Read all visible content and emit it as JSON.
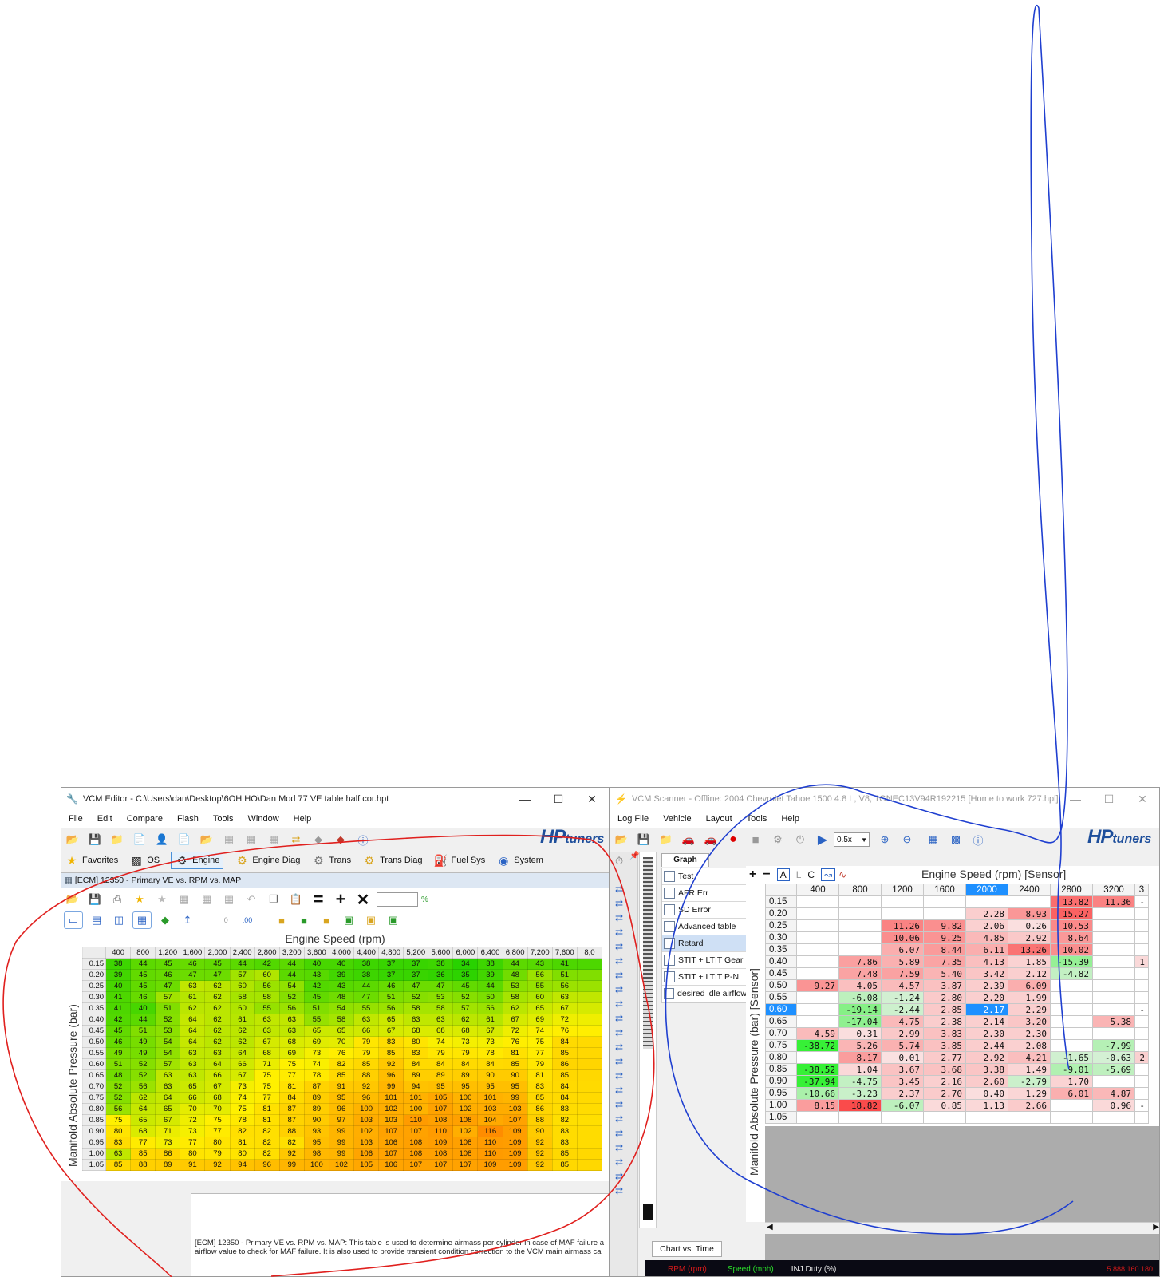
{
  "editor": {
    "title": "VCM Editor - C:\\Users\\dan\\Desktop\\6OH HO\\Dan Mod 77 VE table half cor.hpt",
    "menu": [
      "File",
      "Edit",
      "Compare",
      "Flash",
      "Tools",
      "Window",
      "Help"
    ],
    "logo_hp": "HP",
    "logo_tuners": "tuners",
    "categories": [
      "Favorites",
      "OS",
      "Engine",
      "Engine Diag",
      "Trans",
      "Trans Diag",
      "Fuel Sys",
      "System"
    ],
    "selected_category": "Engine",
    "table_window_title": "[ECM] 12350 - Primary VE vs. RPM vs. MAP",
    "percent_value": "",
    "percent_unit": "%",
    "col_axis_label": "Engine Speed (rpm)",
    "row_axis_label": "Manifold Absolute Pressure (bar)",
    "columns": [
      "400",
      "800",
      "1,200",
      "1,600",
      "2,000",
      "2,400",
      "2,800",
      "3,200",
      "3,600",
      "4,000",
      "4,400",
      "4,800",
      "5,200",
      "5,600",
      "6,000",
      "6,400",
      "6,800",
      "7,200",
      "7,600",
      "8,0"
    ],
    "rows": [
      {
        "p": "0.15",
        "v": [
          38,
          44,
          45,
          46,
          45,
          44,
          42,
          44,
          40,
          40,
          38,
          37,
          37,
          38,
          34,
          38,
          44,
          43,
          41
        ]
      },
      {
        "p": "0.20",
        "v": [
          39,
          45,
          46,
          47,
          47,
          57,
          60,
          44,
          43,
          39,
          38,
          37,
          37,
          36,
          35,
          39,
          48,
          56,
          51
        ]
      },
      {
        "p": "0.25",
        "v": [
          40,
          45,
          47,
          63,
          62,
          60,
          56,
          54,
          42,
          43,
          44,
          46,
          47,
          47,
          45,
          44,
          53,
          55,
          56
        ]
      },
      {
        "p": "0.30",
        "v": [
          41,
          46,
          57,
          61,
          62,
          58,
          58,
          52,
          45,
          48,
          47,
          51,
          52,
          53,
          52,
          50,
          58,
          60,
          63
        ]
      },
      {
        "p": "0.35",
        "v": [
          41,
          40,
          51,
          62,
          62,
          60,
          55,
          56,
          51,
          54,
          55,
          56,
          58,
          58,
          57,
          56,
          62,
          65,
          67
        ]
      },
      {
        "p": "0.40",
        "v": [
          42,
          44,
          52,
          64,
          62,
          61,
          63,
          63,
          55,
          58,
          63,
          65,
          63,
          63,
          62,
          61,
          67,
          69,
          72
        ]
      },
      {
        "p": "0.45",
        "v": [
          45,
          51,
          53,
          64,
          62,
          62,
          63,
          63,
          65,
          65,
          66,
          67,
          68,
          68,
          68,
          67,
          72,
          74,
          76
        ]
      },
      {
        "p": "0.50",
        "v": [
          46,
          49,
          54,
          64,
          62,
          62,
          67,
          68,
          69,
          70,
          79,
          83,
          80,
          74,
          73,
          73,
          76,
          75,
          84
        ]
      },
      {
        "p": "0.55",
        "v": [
          49,
          49,
          54,
          63,
          63,
          64,
          68,
          69,
          73,
          76,
          79,
          85,
          83,
          79,
          79,
          78,
          81,
          77,
          85
        ]
      },
      {
        "p": "0.60",
        "v": [
          51,
          52,
          57,
          63,
          64,
          66,
          71,
          75,
          74,
          82,
          85,
          92,
          84,
          84,
          84,
          84,
          85,
          79,
          86
        ]
      },
      {
        "p": "0.65",
        "v": [
          48,
          52,
          63,
          63,
          66,
          67,
          75,
          77,
          78,
          85,
          88,
          96,
          89,
          89,
          89,
          90,
          90,
          81,
          85
        ]
      },
      {
        "p": "0.70",
        "v": [
          52,
          56,
          63,
          65,
          67,
          73,
          75,
          81,
          87,
          91,
          92,
          99,
          94,
          95,
          95,
          95,
          95,
          83,
          84
        ]
      },
      {
        "p": "0.75",
        "v": [
          52,
          62,
          64,
          66,
          68,
          74,
          77,
          84,
          89,
          95,
          96,
          101,
          101,
          105,
          100,
          101,
          99,
          85,
          84
        ]
      },
      {
        "p": "0.80",
        "v": [
          56,
          64,
          65,
          70,
          70,
          75,
          81,
          87,
          89,
          96,
          100,
          102,
          100,
          107,
          102,
          103,
          103,
          86,
          83
        ]
      },
      {
        "p": "0.85",
        "v": [
          75,
          65,
          67,
          72,
          75,
          78,
          81,
          87,
          90,
          97,
          103,
          103,
          110,
          108,
          108,
          104,
          107,
          88,
          82
        ]
      },
      {
        "p": "0.90",
        "v": [
          80,
          68,
          71,
          73,
          77,
          82,
          82,
          88,
          93,
          99,
          102,
          107,
          107,
          110,
          102,
          116,
          109,
          90,
          83
        ]
      },
      {
        "p": "0.95",
        "v": [
          83,
          77,
          73,
          77,
          80,
          81,
          82,
          82,
          95,
          99,
          103,
          106,
          108,
          109,
          108,
          110,
          109,
          92,
          83
        ]
      },
      {
        "p": "1.00",
        "v": [
          63,
          85,
          86,
          80,
          79,
          80,
          82,
          92,
          98,
          99,
          106,
          107,
          108,
          108,
          108,
          110,
          109,
          92,
          85
        ]
      },
      {
        "p": "1.05",
        "v": [
          85,
          88,
          89,
          91,
          92,
          94,
          96,
          99,
          100,
          102,
          105,
          106,
          107,
          107,
          107,
          109,
          109,
          92,
          85
        ]
      }
    ],
    "description": "[ECM] 12350 - Primary VE vs. RPM vs. MAP: This table is used to determine airmass per cylinder in case of MAF failure a airflow value to check for MAF failure. It is also used to provide transient condition correction to the VCM main airmass ca"
  },
  "scanner": {
    "title": "VCM Scanner - Offline: 2004 Chevrolet Tahoe 1500 4.8 L, V8, 1GNEC13V94R192215 [Home to work 727.hpl]",
    "menu": [
      "Log File",
      "Vehicle",
      "Layout",
      "Tools",
      "Help"
    ],
    "speed_select": "0.5x",
    "logo_hp": "HP",
    "logo_tuners": "tuners",
    "tab_graph": "Graph",
    "tab_chart_time": "Chart vs. Time",
    "sidebar_items": [
      "Test",
      "AFR Err",
      "SD Error",
      "Advanced table",
      "Retard",
      "STIT + LTIT Gear",
      "STIT + LTIT P-N",
      "desired idle airflow"
    ],
    "selected_item": "Retard",
    "toolbar_labels": [
      "+",
      "−",
      "A",
      "L",
      "C"
    ],
    "col_axis_label": "Engine Speed (rpm) [Sensor]",
    "row_axis_label": "Manifold Absolute Pressure (bar) [Sensor]",
    "columns": [
      "400",
      "800",
      "1200",
      "1600",
      "2000",
      "2400",
      "2800",
      "3200",
      "3"
    ],
    "highlight_col": "2000",
    "highlight_row": "0.60",
    "rows": [
      {
        "p": "0.15",
        "v": [
          "",
          "",
          "",
          "",
          "",
          "",
          "13.82",
          "11.36",
          "-"
        ]
      },
      {
        "p": "0.20",
        "v": [
          "",
          "",
          "",
          "",
          "2.28",
          "8.93",
          "15.27",
          "",
          ""
        ]
      },
      {
        "p": "0.25",
        "v": [
          "",
          "",
          "11.26",
          "9.82",
          "2.06",
          "0.26",
          "10.53",
          "",
          ""
        ]
      },
      {
        "p": "0.30",
        "v": [
          "",
          "",
          "10.06",
          "9.25",
          "4.85",
          "2.92",
          "8.64",
          "",
          ""
        ]
      },
      {
        "p": "0.35",
        "v": [
          "",
          "",
          "6.07",
          "8.44",
          "6.11",
          "13.26",
          "10.02",
          "",
          ""
        ]
      },
      {
        "p": "0.40",
        "v": [
          "",
          "7.86",
          "5.89",
          "7.35",
          "4.13",
          "1.85",
          "-15.39",
          "",
          "1"
        ]
      },
      {
        "p": "0.45",
        "v": [
          "",
          "7.48",
          "7.59",
          "5.40",
          "3.42",
          "2.12",
          "-4.82",
          "",
          ""
        ]
      },
      {
        "p": "0.50",
        "v": [
          "9.27",
          "4.05",
          "4.57",
          "3.87",
          "2.39",
          "6.09",
          "",
          "",
          ""
        ]
      },
      {
        "p": "0.55",
        "v": [
          "",
          "-6.08",
          "-1.24",
          "2.80",
          "2.20",
          "1.99",
          "",
          "",
          ""
        ]
      },
      {
        "p": "0.60",
        "v": [
          "",
          "-19.14",
          "-2.44",
          "2.85",
          "2.17",
          "2.29",
          "",
          "",
          "-"
        ]
      },
      {
        "p": "0.65",
        "v": [
          "",
          "-17.04",
          "4.75",
          "2.38",
          "2.14",
          "3.20",
          "",
          "5.38",
          ""
        ]
      },
      {
        "p": "0.70",
        "v": [
          "4.59",
          "0.31",
          "2.99",
          "3.83",
          "2.30",
          "2.30",
          "",
          "",
          ""
        ]
      },
      {
        "p": "0.75",
        "v": [
          "-38.72",
          "5.26",
          "5.74",
          "3.85",
          "2.44",
          "2.08",
          "",
          "-7.99",
          ""
        ]
      },
      {
        "p": "0.80",
        "v": [
          "",
          "8.17",
          "0.01",
          "2.77",
          "2.92",
          "4.21",
          "-1.65",
          "-0.63",
          "2"
        ]
      },
      {
        "p": "0.85",
        "v": [
          "-38.52",
          "1.04",
          "3.67",
          "3.68",
          "3.38",
          "1.49",
          "-9.01",
          "-5.69",
          ""
        ]
      },
      {
        "p": "0.90",
        "v": [
          "-37.94",
          "-4.75",
          "3.45",
          "2.16",
          "2.60",
          "-2.79",
          "1.70",
          "",
          ""
        ]
      },
      {
        "p": "0.95",
        "v": [
          "-10.66",
          "-3.23",
          "2.37",
          "2.70",
          "0.40",
          "1.29",
          "6.01",
          "4.87",
          ""
        ]
      },
      {
        "p": "1.00",
        "v": [
          "8.15",
          "18.82",
          "-6.07",
          "0.85",
          "1.13",
          "2.66",
          "",
          "0.96",
          "-"
        ]
      },
      {
        "p": "1.05",
        "v": [
          "",
          "",
          "",
          "",
          "",
          "",
          "",
          "",
          ""
        ]
      }
    ],
    "status_labels": [
      "RPM (rpm)",
      "Speed (mph)",
      "INJ Duty (%)"
    ],
    "status_values": "5.888  160  180"
  },
  "colors": {
    "annotation_red": "#e0201e",
    "annotation_blue": "#1f3fd0",
    "brand_blue": "#1d4e9b",
    "selection_blue": "#1e90ff"
  }
}
